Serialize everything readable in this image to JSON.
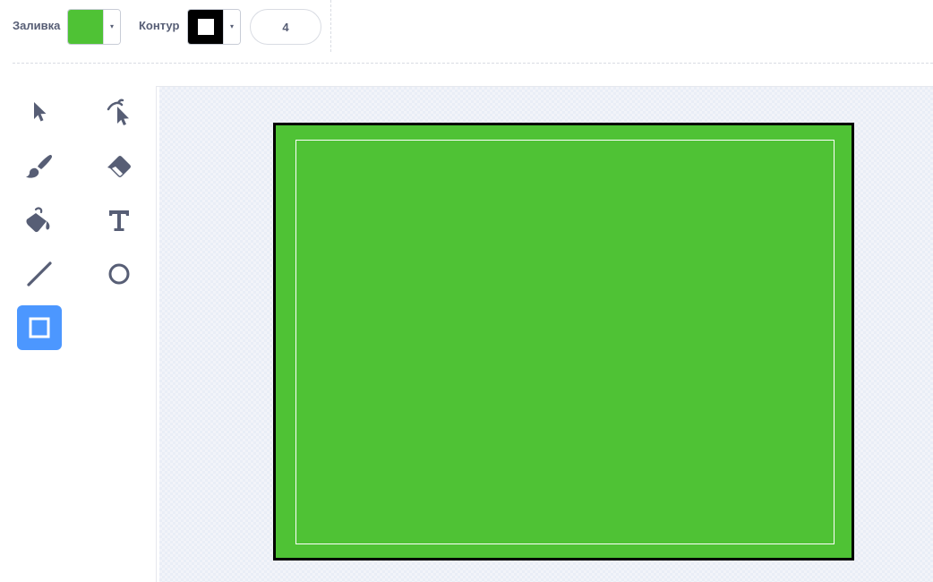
{
  "toolbar": {
    "fill_label": "Заливка",
    "fill_color": "#4fc235",
    "outline_label": "Контур",
    "outline_color": "#000000",
    "outline_width": "4",
    "dropdown_arrow": "▾"
  },
  "tools": [
    {
      "name": "select",
      "icon": "arrow-pointer-icon",
      "active": false
    },
    {
      "name": "reshape",
      "icon": "reshape-pointer-icon",
      "active": false
    },
    {
      "name": "brush",
      "icon": "brush-icon",
      "active": false
    },
    {
      "name": "eraser",
      "icon": "eraser-icon",
      "active": false
    },
    {
      "name": "fill",
      "icon": "paint-bucket-icon",
      "active": false
    },
    {
      "name": "text",
      "icon": "text-t-icon",
      "active": false
    },
    {
      "name": "line",
      "icon": "line-icon",
      "active": false
    },
    {
      "name": "circle",
      "icon": "circle-icon",
      "active": false
    },
    {
      "name": "rectangle",
      "icon": "rectangle-icon",
      "active": true
    }
  ],
  "colors": {
    "icon": "#575e75",
    "active_tool_bg": "#4c97ff",
    "shape_fill": "#4fc235",
    "shape_stroke": "#000000"
  },
  "canvas": {
    "shape": "rectangle",
    "fill": "#4fc235",
    "stroke": "#000000"
  }
}
